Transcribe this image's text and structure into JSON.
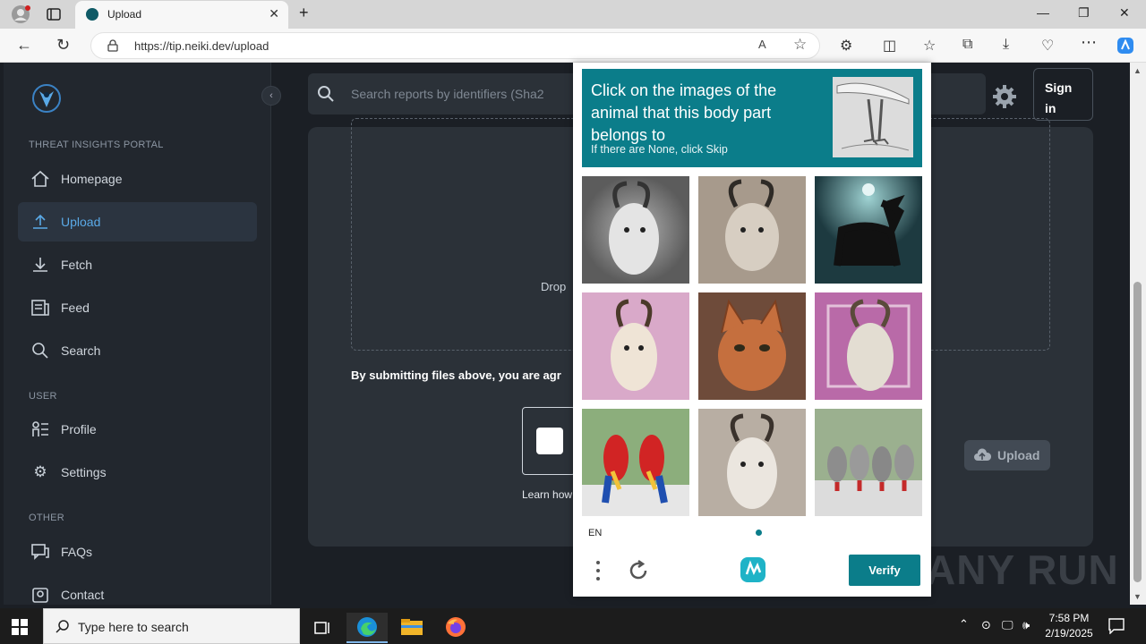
{
  "browser": {
    "tab_title": "Upload",
    "url": "https://tip.neiki.dev/upload"
  },
  "sidebar": {
    "portal_label": "THREAT INSIGHTS PORTAL",
    "items": [
      {
        "label": "Homepage",
        "icon": "home-icon"
      },
      {
        "label": "Upload",
        "icon": "upload-icon",
        "active": true
      },
      {
        "label": "Fetch",
        "icon": "download-icon"
      },
      {
        "label": "Feed",
        "icon": "feed-icon"
      },
      {
        "label": "Search",
        "icon": "search-icon"
      }
    ],
    "user_section": "USER",
    "user_items": [
      {
        "label": "Profile",
        "icon": "profile-icon"
      },
      {
        "label": "Settings",
        "icon": "gear-icon"
      }
    ],
    "other_section": "OTHER",
    "other_items": [
      {
        "label": "FAQs",
        "icon": "faq-icon"
      },
      {
        "label": "Contact",
        "icon": "contact-icon"
      }
    ]
  },
  "header": {
    "search_placeholder": "Search reports by identifiers (Sha2",
    "signin_label": "Sign in"
  },
  "main": {
    "drop_text": "Drop",
    "terms_text": "By submitting files above, you are agr",
    "learn_text": "Learn how",
    "upload_button": "Upload"
  },
  "captcha": {
    "prompt": "Click on the images of the animal that this body part belongs to",
    "subprompt": "If there are None, click Skip",
    "tiles": [
      "goat",
      "goat",
      "black cat",
      "goat",
      "cat",
      "goat",
      "parrots",
      "goat",
      "parrots"
    ],
    "language": "EN",
    "verify_label": "Verify"
  },
  "watermark": "ANY RUN",
  "taskbar": {
    "search_placeholder": "Type here to search",
    "time": "7:58 PM",
    "date": "2/19/2025"
  },
  "colors": {
    "accent": "#0b7d8a",
    "sidebar_active": "#5aa9e6"
  }
}
